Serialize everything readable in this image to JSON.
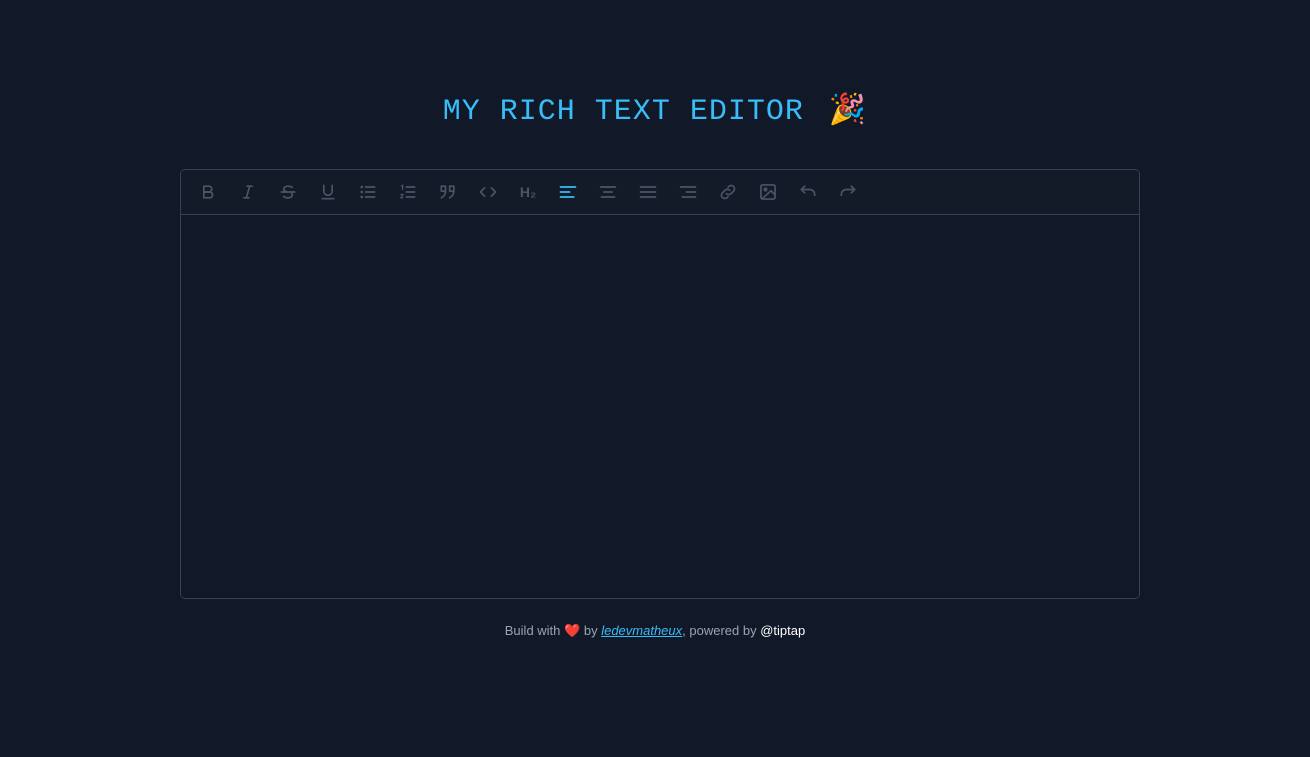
{
  "header": {
    "title": "MY RICH TEXT EDITOR",
    "title_emoji": "🎉"
  },
  "toolbar": {
    "items": [
      {
        "name": "bold-icon",
        "active": false
      },
      {
        "name": "italic-icon",
        "active": false
      },
      {
        "name": "strikethrough-icon",
        "active": false
      },
      {
        "name": "underline-icon",
        "active": false
      },
      {
        "name": "bullet-list-icon",
        "active": false
      },
      {
        "name": "ordered-list-icon",
        "active": false
      },
      {
        "name": "blockquote-icon",
        "active": false
      },
      {
        "name": "code-icon",
        "active": false
      },
      {
        "name": "heading-2-icon",
        "active": false,
        "label": "H₂"
      },
      {
        "name": "align-left-icon",
        "active": true
      },
      {
        "name": "align-center-icon",
        "active": false
      },
      {
        "name": "align-justify-icon",
        "active": false
      },
      {
        "name": "align-right-icon",
        "active": false
      },
      {
        "name": "link-icon",
        "active": false
      },
      {
        "name": "image-icon",
        "active": false
      },
      {
        "name": "undo-icon",
        "active": false
      },
      {
        "name": "redo-icon",
        "active": false
      }
    ],
    "active_color": "#38bdf8",
    "inactive_color": "#4b5563"
  },
  "editor": {
    "content": ""
  },
  "footer": {
    "prefix": "Build with",
    "heart": "❤️",
    "by": "by",
    "author": "ledevmatheux",
    "powered": ", powered by",
    "tiptap": "@tiptap"
  },
  "colors": {
    "background": "#111827",
    "accent": "#38bdf8",
    "border": "#374151"
  }
}
